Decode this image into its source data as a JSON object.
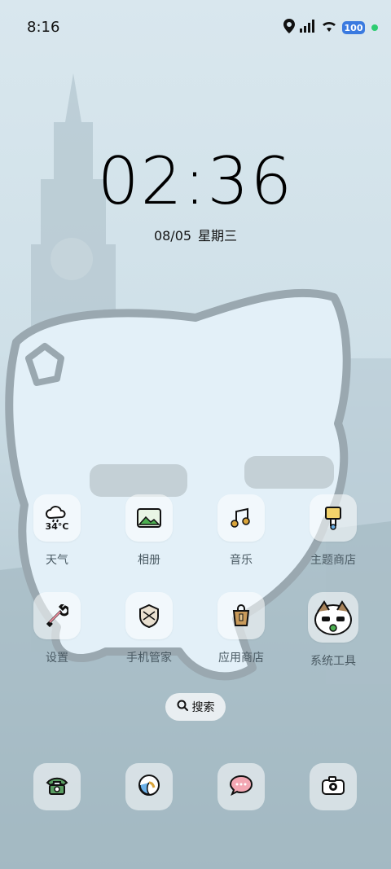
{
  "status_bar": {
    "time": "8:16",
    "battery_level": "100",
    "icons": [
      "location-icon",
      "signal-icon",
      "wifi-icon",
      "battery-icon"
    ]
  },
  "clock": {
    "time": "02:36",
    "date": "08/05",
    "weekday": "星期三"
  },
  "apps": [
    {
      "label": "天气",
      "icon": "weather-icon",
      "temperature": "34°C"
    },
    {
      "label": "相册",
      "icon": "gallery-icon"
    },
    {
      "label": "音乐",
      "icon": "music-icon"
    },
    {
      "label": "主题商店",
      "icon": "theme-store-icon"
    },
    {
      "label": "设置",
      "icon": "settings-icon"
    },
    {
      "label": "手机管家",
      "icon": "phone-manager-icon"
    },
    {
      "label": "应用商店",
      "icon": "app-store-icon"
    },
    {
      "label": "系统工具",
      "icon": "system-tools-folder-icon"
    }
  ],
  "search": {
    "label": "搜索"
  },
  "dock": [
    {
      "icon": "phone-icon"
    },
    {
      "icon": "browser-icon"
    },
    {
      "icon": "messages-icon"
    },
    {
      "icon": "camera-icon"
    }
  ],
  "colors": {
    "accent_battery": "#3a7ae0",
    "status_dot": "#2ecc71",
    "wallpaper": "#cfe0e8"
  }
}
